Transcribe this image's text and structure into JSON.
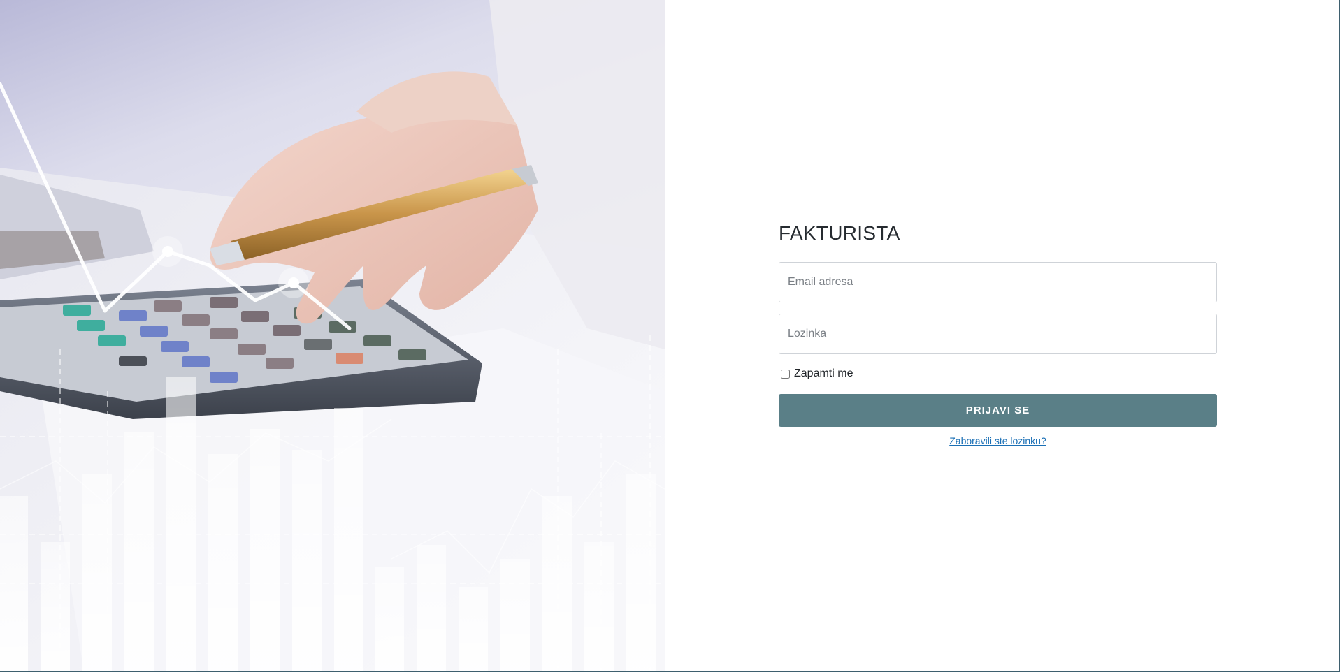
{
  "brand": {
    "title": "FAKTURISTA"
  },
  "login_form": {
    "email_placeholder": "Email adresa",
    "password_placeholder": "Lozinka",
    "remember_label": "Zapamti me",
    "remember_checked": false,
    "submit_label": "PRIJAVI SE",
    "forgot_link": "Zaboravili ste lozinku?"
  },
  "colors": {
    "primary_button": "#5a7f87",
    "link": "#1a6fb5",
    "border_accent": "#3e5f6e"
  },
  "hero": {
    "image_subject": "hand with pen on calculator, rising bar chart overlay"
  }
}
